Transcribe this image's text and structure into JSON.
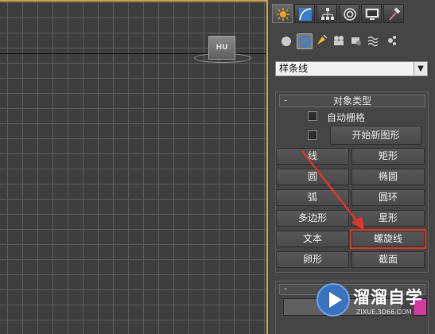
{
  "command_panel": {
    "tabs": [
      {
        "icon": "create-sun-icon",
        "active": true
      },
      {
        "icon": "modify-curve-icon",
        "active": false
      },
      {
        "icon": "hierarchy-icon",
        "active": false
      },
      {
        "icon": "motion-icon",
        "active": false
      },
      {
        "icon": "display-monitor-icon",
        "active": false
      },
      {
        "icon": "utilities-hammer-icon",
        "active": false
      }
    ],
    "sub_categories": [
      {
        "icon": "geometry-sphere-icon",
        "active": false
      },
      {
        "icon": "shapes-icon",
        "active": true
      },
      {
        "icon": "lights-icon",
        "active": false
      },
      {
        "icon": "cameras-icon",
        "active": false
      },
      {
        "icon": "helpers-icon",
        "active": false
      },
      {
        "icon": "space-warps-icon",
        "active": false
      },
      {
        "icon": "systems-icon",
        "active": false
      }
    ],
    "category_dropdown": {
      "value": "样条线"
    },
    "object_type_rollout": {
      "collapse_symbol": "-",
      "title": "对象类型",
      "autogrid_label": "自动栅格",
      "start_new_shape_label": "开始新图形",
      "buttons": [
        {
          "label": "线",
          "highlighted": false
        },
        {
          "label": "矩形",
          "highlighted": false
        },
        {
          "label": "圆",
          "highlighted": false
        },
        {
          "label": "椭圆",
          "highlighted": false
        },
        {
          "label": "弧",
          "highlighted": false
        },
        {
          "label": "圆环",
          "highlighted": false
        },
        {
          "label": "多边形",
          "highlighted": false
        },
        {
          "label": "星形",
          "highlighted": false
        },
        {
          "label": "文本",
          "highlighted": false
        },
        {
          "label": "螺旋线",
          "highlighted": true
        },
        {
          "label": "卵形",
          "highlighted": false
        },
        {
          "label": "截面",
          "highlighted": false
        }
      ]
    },
    "second_rollout": {
      "collapse_symbol": "-",
      "swatch_color": "#d33a9e"
    }
  },
  "viewport": {
    "viewcube_label": "HU"
  },
  "watermark": {
    "text": "溜溜自学",
    "url": "ZIXUE.3D66.COM"
  },
  "colors": {
    "viewport_border": "#c9a24a",
    "highlight": "#e0352a",
    "arrow": "#e0352a"
  }
}
